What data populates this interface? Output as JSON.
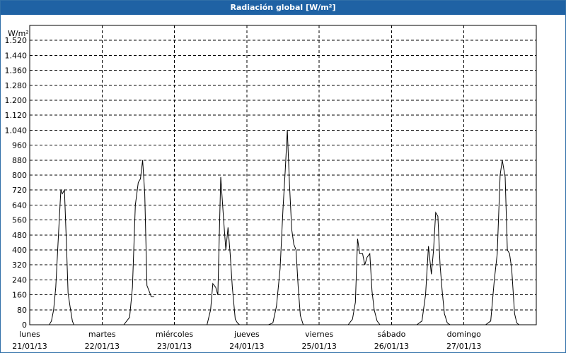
{
  "window": {
    "title": "Radiación global [W/m²]"
  },
  "chart_data": {
    "type": "line",
    "title": "Radiación global [W/m²]",
    "ylabel": "W/m²",
    "xlabel": "",
    "ylim": [
      0,
      1600
    ],
    "yticks": [
      "0",
      "80",
      "160",
      "240",
      "320",
      "400",
      "480",
      "560",
      "640",
      "720",
      "800",
      "880",
      "960",
      "1.040",
      "1.120",
      "1.200",
      "1.280",
      "1.360",
      "1.440",
      "1.520"
    ],
    "ytick_values": [
      0,
      80,
      160,
      240,
      320,
      400,
      480,
      560,
      640,
      720,
      800,
      880,
      960,
      1040,
      1120,
      1200,
      1280,
      1360,
      1440,
      1520
    ],
    "xlim": [
      0,
      7
    ],
    "days": [
      {
        "name": "lunes",
        "date": "21/01/13"
      },
      {
        "name": "martes",
        "date": "22/01/13"
      },
      {
        "name": "miércoles",
        "date": "23/01/13"
      },
      {
        "name": "jueves",
        "date": "24/01/13"
      },
      {
        "name": "viernes",
        "date": "25/01/13"
      },
      {
        "name": "sábado",
        "date": "26/01/13"
      },
      {
        "name": "domingo",
        "date": "27/01/13"
      }
    ],
    "grid": true,
    "series": [
      {
        "x": [
          0,
          0.27,
          0.3,
          0.33,
          0.36,
          0.4,
          0.43,
          0.45,
          0.48,
          0.51,
          0.53,
          0.56,
          0.59,
          0.61,
          0.64,
          0.67,
          0.7,
          0.73,
          0.75,
          0.78,
          0.81,
          0.83
        ],
        "y": [
          0,
          0,
          20,
          80,
          200,
          500,
          720,
          700,
          720,
          400,
          170,
          90,
          20,
          0,
          0,
          0,
          0,
          0,
          0,
          0,
          0,
          0
        ]
      },
      {
        "x": [
          1.3,
          1.34,
          1.38,
          1.42,
          1.46,
          1.5,
          1.53,
          1.56,
          1.59,
          1.62,
          1.65,
          1.68,
          1.72
        ],
        "y": [
          0,
          20,
          40,
          200,
          640,
          760,
          780,
          880,
          700,
          210,
          180,
          150,
          150
        ]
      },
      {
        "x": [
          2,
          2.3,
          2.45,
          2.5,
          2.53,
          2.57,
          2.6,
          2.64,
          2.68,
          2.71,
          2.74,
          2.77,
          2.8,
          2.84,
          2.87,
          2.9,
          2.93,
          2.96,
          3
        ],
        "y": [
          0,
          0,
          0,
          80,
          220,
          200,
          160,
          790,
          560,
          400,
          520,
          380,
          200,
          30,
          10,
          0,
          0,
          0,
          0
        ]
      },
      {
        "x": [
          3,
          3.3,
          3.36,
          3.41,
          3.46,
          3.5,
          3.53,
          3.56,
          3.59,
          3.62,
          3.65,
          3.68,
          3.71,
          3.74,
          3.78,
          3.84,
          4
        ],
        "y": [
          0,
          0,
          10,
          100,
          300,
          620,
          820,
          1040,
          750,
          510,
          430,
          400,
          200,
          50,
          0,
          0,
          0
        ]
      },
      {
        "x": [
          4,
          4.4,
          4.46,
          4.5,
          4.53,
          4.56,
          4.6,
          4.63,
          4.66,
          4.7,
          4.73,
          4.76,
          4.8,
          4.84,
          4.9,
          5
        ],
        "y": [
          0,
          0,
          30,
          120,
          460,
          380,
          380,
          320,
          360,
          380,
          180,
          80,
          20,
          0,
          0,
          0
        ]
      },
      {
        "x": [
          5,
          5.35,
          5.42,
          5.47,
          5.51,
          5.55,
          5.58,
          5.61,
          5.64,
          5.67,
          5.7,
          5.73,
          5.77,
          5.81,
          5.85,
          5.9,
          6
        ],
        "y": [
          0,
          0,
          20,
          160,
          420,
          270,
          400,
          600,
          580,
          320,
          180,
          60,
          10,
          0,
          0,
          0,
          0
        ]
      },
      {
        "x": [
          6,
          6.3,
          6.37,
          6.42,
          6.46,
          6.5,
          6.53,
          6.57,
          6.6,
          6.63,
          6.66,
          6.7,
          6.73,
          6.76,
          6.8,
          7
        ],
        "y": [
          0,
          0,
          20,
          240,
          380,
          800,
          880,
          790,
          400,
          380,
          300,
          60,
          10,
          0,
          0,
          0
        ]
      }
    ]
  }
}
